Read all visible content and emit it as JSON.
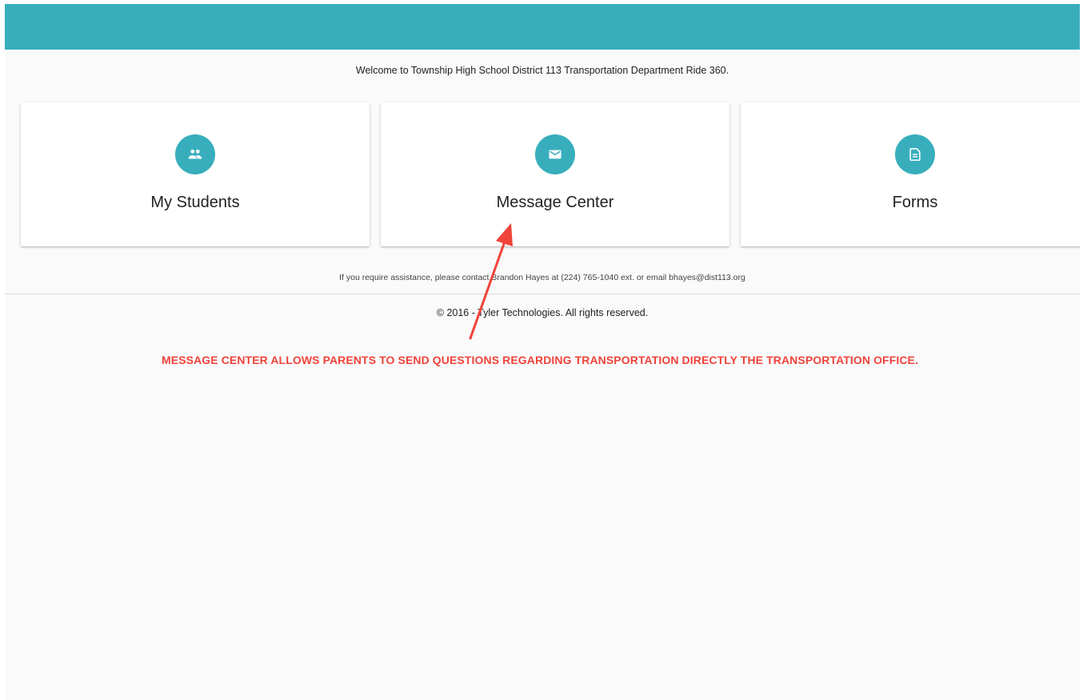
{
  "colors": {
    "header": "#38aebd",
    "accent": "#38aebd",
    "annotation": "#f0433a"
  },
  "welcome_text": "Welcome to Township High School District 113 Transportation Department Ride 360.",
  "cards": [
    {
      "label": "My Students",
      "icon": "people-icon"
    },
    {
      "label": "Message Center",
      "icon": "mail-icon"
    },
    {
      "label": "Forms",
      "icon": "document-icon"
    }
  ],
  "assistance_text": "If you require assistance, please contact Brandon Hayes at (224) 765-1040 ext. or email bhayes@dist113.org",
  "copyright_text": "© 2016 - Tyler Technologies. All rights reserved.",
  "annotation_text": "MESSAGE CENTER ALLOWS PARENTS TO SEND QUESTIONS REGARDING TRANSPORTATION DIRECTLY THE TRANSPORTATION OFFICE."
}
